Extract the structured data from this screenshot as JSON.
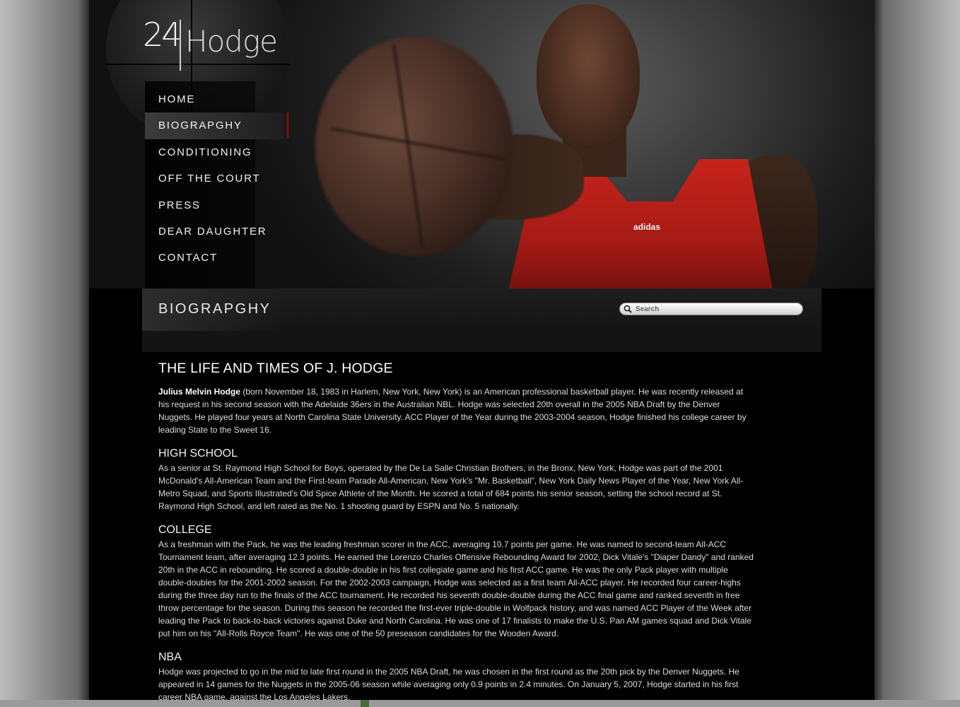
{
  "logo": {
    "number": "24",
    "name": "Hodge"
  },
  "nav": {
    "items": [
      {
        "label": "HOME",
        "active": false
      },
      {
        "label": "BIOGRAPGHY",
        "active": true
      },
      {
        "label": "CONDITIONING",
        "active": false
      },
      {
        "label": "OFF THE COURT",
        "active": false
      },
      {
        "label": "PRESS",
        "active": false
      },
      {
        "label": "DEAR DAUGHTER",
        "active": false
      },
      {
        "label": "CONTACT",
        "active": false
      }
    ]
  },
  "hero": {
    "jersey_brand": "adidas"
  },
  "page_title": "BIOGRAPGHY",
  "search": {
    "placeholder": "Search",
    "value": ""
  },
  "content": {
    "heading": "THE LIFE AND TIMES OF J. HODGE",
    "intro_bold": "Julius Melvin Hodge",
    "intro_rest": " (born November 18, 1983 in Harlem, New York, New York) is an American professional basketball player. He was recently released at his request in his second season with the Adelaide 36ers in the Australian NBL. Hodge was selected 20th overall in the 2005 NBA Draft by the Denver Nuggets. He played four years at North Carolina State University. ACC Player of the Year during the 2003-2004 season, Hodge finished his college career by leading State to the Sweet 16.",
    "sections": [
      {
        "title": "HIGH SCHOOL",
        "text": "As a senior at St. Raymond High School for Boys, operated by the De La Salle Christian Brothers, in the Bronx, New York, Hodge was part of the 2001 McDonald's All-American Team and the First-team Parade All-American, New York's \"Mr. Basketball\", New York Daily News Player of the Year, New York All-Metro Squad, and Sports Illustrated's Old Spice Athlete of the Month. He scored a total of 684 points his senior season, setting the school record at St. Raymond High School, and left rated as the No. 1 shooting guard by ESPN and No. 5 nationally."
      },
      {
        "title": "COLLEGE",
        "text": "As a freshman with the Pack, he was the leading freshman scorer in the ACC, averaging 10.7 points per game. He was named to second-team All-ACC Tournament team, after averaging 12.3 points. He earned the Lorenzo Charles Offensive Rebounding Award for 2002, Dick Vitale's \"Diaper Dandy\" and ranked 20th in the ACC in rebounding. He scored a double-double in his first collegiate game and his first ACC game. He was the only Pack player with multiple double-doubles for the 2001-2002 season. For the 2002-2003 campaign, Hodge was selected as a first team All-ACC player. He recorded four career-highs during the three day run to the finals of the ACC tournament. He recorded his seventh double-double during the ACC final game and ranked seventh in free throw percentage for the season. During this season he recorded the first-ever triple-double in Wolfpack history, and was named ACC Player of the Week after leading the Pack to back-to-back victories against Duke and North Carolina. He was one of 17 finalists to make the U.S. Pan AM games squad and Dick Vitale put him on his \"All-Rolls Royce Team\". He was one of the 50 preseason candidates for the Wooden Award."
      },
      {
        "title": "NBA",
        "text": "Hodge was projected to go in the mid to late first round in the 2005 NBA Draft, he was chosen in the first round as the 20th pick by the Denver Nuggets. He appeared in 14 games for the Nuggets in the 2005-06 season while averaging only 0.9 points in 2.4 minutes. On January 5, 2007, Hodge started in his first career NBA game, against the Los Angeles Lakers."
      }
    ]
  }
}
